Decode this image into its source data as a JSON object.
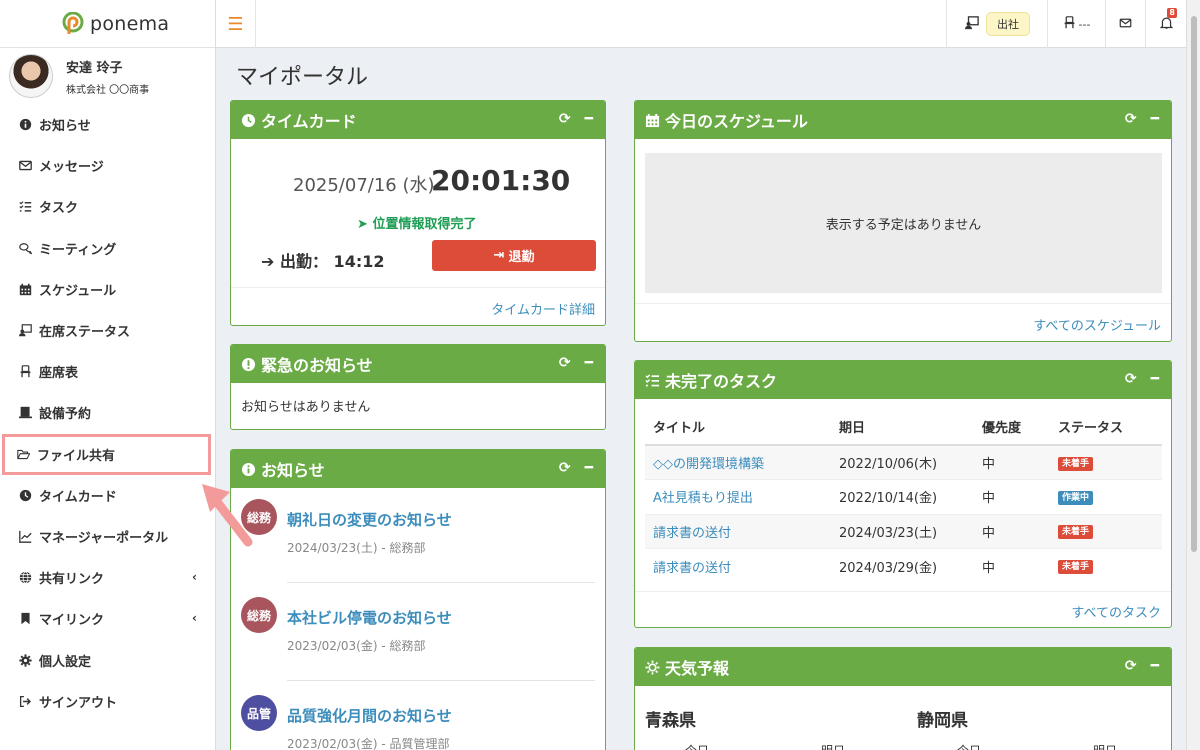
{
  "app": {
    "logo_text": "ponema"
  },
  "user": {
    "name": "安達 玲子",
    "company": "株式会社 〇〇商事"
  },
  "sidebar": {
    "items": [
      {
        "label": "お知らせ",
        "icon": "info-circle-icon"
      },
      {
        "label": "メッセージ",
        "icon": "envelope-icon"
      },
      {
        "label": "タスク",
        "icon": "tasks-icon"
      },
      {
        "label": "ミーティング",
        "icon": "comments-icon"
      },
      {
        "label": "スケジュール",
        "icon": "calendar-icon"
      },
      {
        "label": "在席ステータス",
        "icon": "presence-icon"
      },
      {
        "label": "座席表",
        "icon": "chair-icon"
      },
      {
        "label": "設備予約",
        "icon": "facility-icon"
      },
      {
        "label": "ファイル共有",
        "icon": "folder-open-icon"
      },
      {
        "label": "タイムカード",
        "icon": "clock-icon"
      },
      {
        "label": "マネージャーポータル",
        "icon": "chart-line-icon"
      },
      {
        "label": "共有リンク",
        "icon": "globe-icon"
      },
      {
        "label": "マイリンク",
        "icon": "bookmark-icon"
      },
      {
        "label": "個人設定",
        "icon": "gear-icon"
      },
      {
        "label": "サインアウト",
        "icon": "sign-out-icon"
      }
    ]
  },
  "topbar": {
    "status_label": "出社",
    "seat_text": "---",
    "notification_count": "8"
  },
  "page": {
    "title": "マイポータル"
  },
  "timecard": {
    "title": "タイムカード",
    "date": "2025/07/16 (水)",
    "time": "20:01:30",
    "location_status": "位置情報取得完了",
    "clock_in": "出勤： 14:12",
    "clock_out_button": "退勤",
    "detail_link": "タイムカード詳細"
  },
  "urgent": {
    "title": "緊急のお知らせ",
    "empty": "お知らせはありません"
  },
  "news": {
    "title": "お知らせ",
    "items": [
      {
        "badge": "総務",
        "title": "朝礼日の変更のお知らせ",
        "meta": "2024/03/23(土) - 総務部"
      },
      {
        "badge": "総務",
        "title": "本社ビル停電のお知らせ",
        "meta": "2023/02/03(金) - 総務部"
      },
      {
        "badge": "品管",
        "title": "品質強化月間のお知らせ",
        "meta": "2023/02/03(金) - 品質管理部"
      }
    ]
  },
  "schedule": {
    "title": "今日のスケジュール",
    "empty": "表示する予定はありません",
    "link": "すべてのスケジュール"
  },
  "tasks": {
    "title": "未完了のタスク",
    "columns": [
      "タイトル",
      "期日",
      "優先度",
      "ステータス"
    ],
    "rows": [
      {
        "title": "◇◇の開発環境構築",
        "due": "2022/10/06(木)",
        "priority": "中",
        "status": "未着手"
      },
      {
        "title": "A社見積もり提出",
        "due": "2022/10/14(金)",
        "priority": "中",
        "status": "作業中"
      },
      {
        "title": "請求書の送付",
        "due": "2024/03/23(土)",
        "priority": "中",
        "status": "未着手"
      },
      {
        "title": "請求書の送付",
        "due": "2024/03/29(金)",
        "priority": "中",
        "status": "未着手"
      }
    ],
    "link": "すべてのタスク"
  },
  "weather": {
    "title": "天気予報",
    "prefectures": [
      "青森県",
      "静岡県"
    ],
    "days": [
      "今日",
      "明日"
    ]
  },
  "colors": {
    "accent": "#6aab45",
    "link": "#3c8dbc",
    "danger": "#dd4b39",
    "info": "#3c8dbc",
    "highlight": "#f39a9a"
  }
}
